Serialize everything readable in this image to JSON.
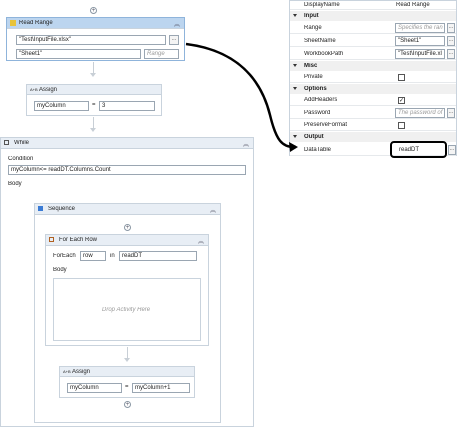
{
  "read_range": {
    "title": "Read Range",
    "workbook_value": "\"Test\\InputFile.xlsx\"",
    "sheet_value": "\"Sheet1\"",
    "range_placeholder": "Range",
    "browse_label": "..."
  },
  "assign1": {
    "title": "Assign",
    "badge": "A+B",
    "left": "myColumn",
    "op": "=",
    "right": "3"
  },
  "while": {
    "title": "While",
    "condition_label": "Condition",
    "condition_value": "myColumn<= readDT.Columns.Count",
    "body_label": "Body"
  },
  "sequence": {
    "title": "Sequence"
  },
  "for_each_row": {
    "title": "For Each Row",
    "foreach_label": "ForEach",
    "item_value": "row",
    "in_label": "in",
    "collection_value": "readDT",
    "body_label": "Body",
    "drop_hint": "Drop Activity Here"
  },
  "assign2": {
    "title": "Assign",
    "badge": "A+B",
    "left": "myColumn",
    "op": "=",
    "right": "myColumn+1"
  },
  "properties": {
    "display_name_label": "DisplayName",
    "display_name_value": "Read Range",
    "input_category": "Input",
    "range_label": "Range",
    "range_hint": "Specifies the ran",
    "sheetname_label": "SheetName",
    "sheetname_value": "\"Sheet1\"",
    "workbookpath_label": "WorkbookPath",
    "workbookpath_value": "\"Test\\InputFile.xl",
    "misc_category": "Misc",
    "private_label": "Private",
    "options_category": "Options",
    "addheaders_label": "AddHeaders",
    "password_label": "Password",
    "password_hint": "The password of",
    "preserveformat_label": "PreserveFormat",
    "output_category": "Output",
    "datatable_label": "DataTable",
    "datatable_value": "readDT",
    "browse_label": "..."
  },
  "icons": {
    "expand": "double-chevron-up-icon",
    "add": "plus-circle-icon"
  }
}
